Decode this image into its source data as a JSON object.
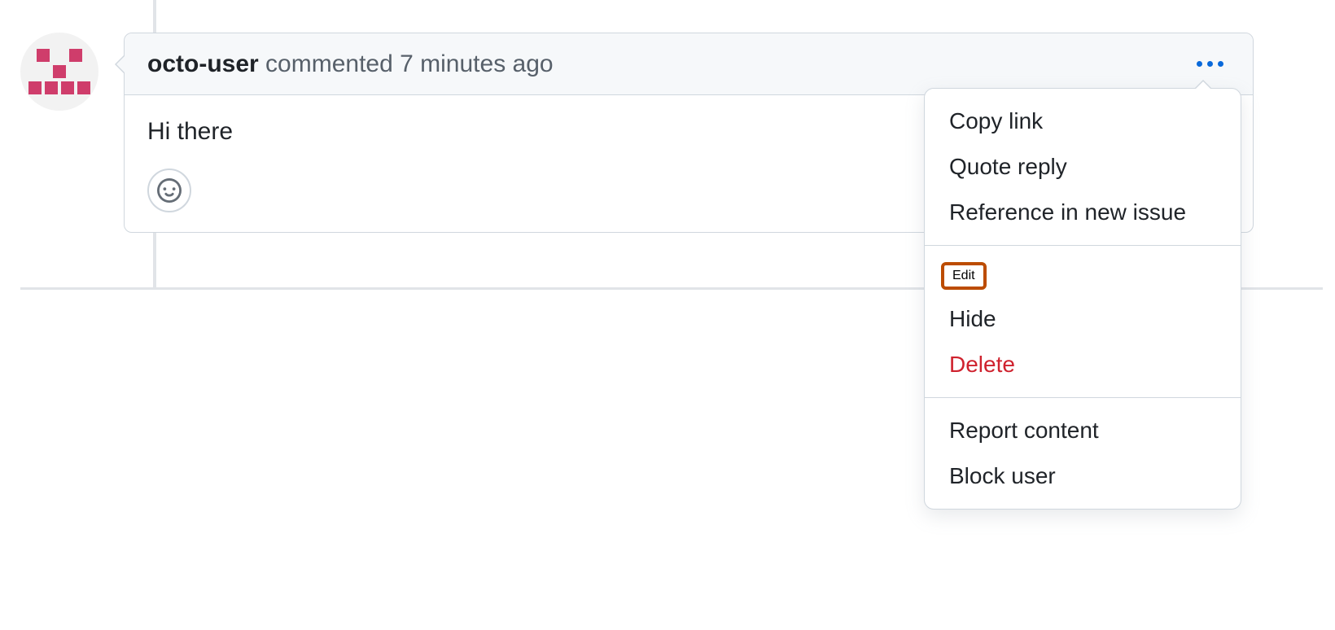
{
  "comment": {
    "username": "octo-user",
    "action_text": "commented",
    "timestamp": "7 minutes ago",
    "body": "Hi there"
  },
  "menu": {
    "copy_link": "Copy link",
    "quote_reply": "Quote reply",
    "reference_new_issue": "Reference in new issue",
    "edit": "Edit",
    "hide": "Hide",
    "delete": "Delete",
    "report_content": "Report content",
    "block_user": "Block user"
  }
}
